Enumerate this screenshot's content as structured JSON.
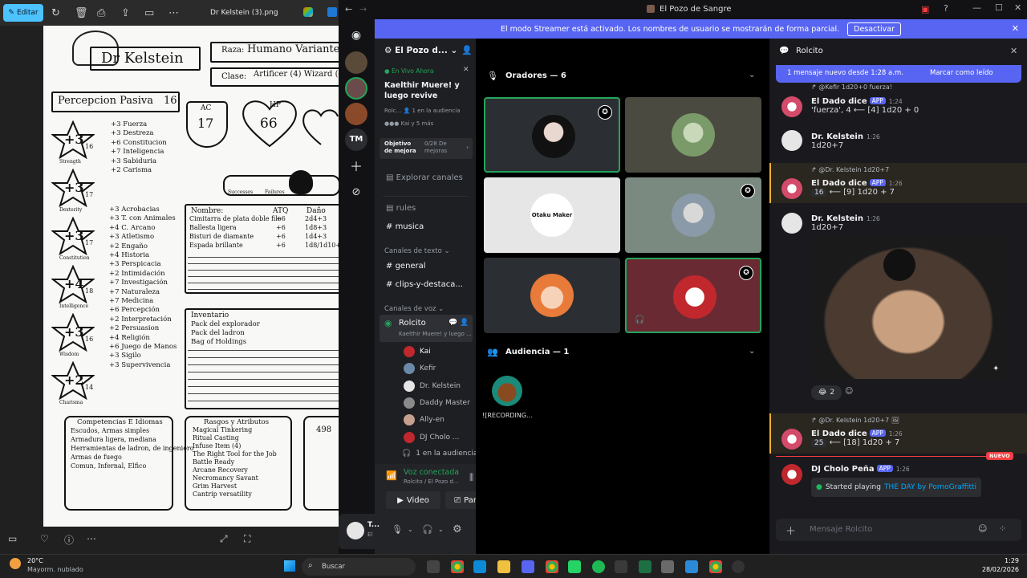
{
  "viewer": {
    "edit_label": "Editar",
    "file_title": "Dr Kelstein (3).png",
    "sheet": {
      "name": "Dr Kelstein",
      "race_label": "Raza:",
      "race": "Humano Variante",
      "class_label": "Clase:",
      "class": "Artificer (4) Wizard (4)",
      "passive_label": "Percepcion Pasiva",
      "passive": "16",
      "ac_label": "AC",
      "ac": "17",
      "hp_label": "HP",
      "hp": "66",
      "successes": "Successes",
      "failures": "Failures",
      "stats": [
        {
          "mod": "+3",
          "score": "16",
          "name": "Strength"
        },
        {
          "mod": "+3",
          "score": "17",
          "name": "Dexterity"
        },
        {
          "mod": "+3",
          "score": "17",
          "name": "Constitution"
        },
        {
          "mod": "+4",
          "score": "18",
          "name": "Intelligence"
        },
        {
          "mod": "+3",
          "score": "16",
          "name": "Wisdom"
        },
        {
          "mod": "+2",
          "score": "14",
          "name": "Charisma"
        }
      ],
      "saves": [
        "+3 Fuerza",
        "+3 Destreza",
        "+6 Constitucion",
        "+7 Inteligencia",
        "+3 Sabiduria",
        "+2 Carisma"
      ],
      "skills": [
        "+3 Acrobacias",
        "+3 T. con Animales",
        "+4 C. Arcano",
        "+3 Atletismo",
        "+2 Engaño",
        "+4 Historia",
        "+3 Perspicacia",
        "+2 Intimidación",
        "+7 Investigación",
        "+7 Naturaleza",
        "+7 Medicina",
        "+6 Percepción",
        "+2 Interpretación",
        "+2 Persuasion",
        "+4 Religión",
        "+6 Juego de Manos",
        "+3 Sigilo",
        "+3 Supervivencia"
      ],
      "attack_headers": [
        "Nombre:",
        "ATQ",
        "Daño"
      ],
      "attacks": [
        [
          "Cimitarra de plata doble filo",
          "+6",
          "2d4+3"
        ],
        [
          "Ballesta ligera",
          "+6",
          "1d8+3"
        ],
        [
          "Bisturi de diamante",
          "+6",
          "1d4+3"
        ],
        [
          "Espada brillante",
          "+6",
          "1d8/1d10+"
        ]
      ],
      "inventory_title": "Inventario",
      "inventory": [
        "Pack del explorador",
        "Pack del ladron",
        "Bag of Holdings"
      ],
      "prof_title": "Competencias E Idiomas",
      "prof": [
        "Escudos, Armas simples",
        "Armadura ligera, mediana",
        "Herramientas de ladron, de ingeniero",
        "Armas de fuego",
        "Comun, Infernal, Elfico"
      ],
      "traits_title": "Rasgos y Atributos",
      "traits": [
        "Magical Tinkering",
        "Ritual Casting",
        "Infuse Item (4)",
        "The Right Tool for the Job",
        "Battle Ready",
        "Arcane Recovery",
        "Necromancy Savant",
        "Grim Harvest",
        "Cantrip versatility"
      ],
      "side_num": "498"
    }
  },
  "discord": {
    "window_title": "El Pozo de Sangre",
    "streamer_text": "El modo Streamer está activado. Los nombres de usuario se mostrarán de forma parcial.",
    "streamer_button": "Desactivar",
    "guild_tm": "TM",
    "server_name": "El Pozo d...",
    "live_now": "En Vivo Ahora",
    "stage_title": "Kaelthir Muere! y luego revive",
    "stage_sub": "Rolc...",
    "stage_audience": "1 en la audiencia",
    "stage_people": "Kai y 5 más",
    "boost_label": "Objetivo de mejora",
    "boost_value": "0/28 De mejoras",
    "explore": "Explorar canales",
    "channels_top": [
      "rules",
      "musica"
    ],
    "text_cat": "Canales de texto",
    "text_channels": [
      "general",
      "clips-y-destaca..."
    ],
    "voice_cat": "Canales de voz",
    "voice_channel": "Rolcito",
    "voice_sub": "Kaelthir Muere! y luego ...",
    "voice_users": [
      "Kai",
      "Kefir",
      "Dr. Kelstein",
      "Daddy Master",
      "Ally-en",
      "DJ Cholo ..."
    ],
    "voice_audience": "1 en la audiencia",
    "voice_connected": "Voz conectada",
    "voice_connected_sub": "Rolcito / El Pozo d...",
    "video_btn": "Video",
    "screen_btn": "Pantall",
    "user_name": "T...",
    "user_status": "El",
    "speakers_title": "Oradores — 6",
    "audience_title": "Audiencia — 1",
    "audience_member": "![RECORDING...",
    "tile_logo": "Otaku Maker",
    "chat": {
      "channel": "Rolcito",
      "new_banner": "1 mensaje nuevo desde 1:28 a.m.",
      "mark_read": "Marcar como leído",
      "messages": [
        {
          "reply": "@Kefir 1d20+0 fuerza!",
          "user": "El Dado dice",
          "tag": "APP",
          "time": "1:24",
          "text": "'fuerza', 4 ⟵ [4] 1d20 + 0"
        },
        {
          "user": "Dr. Kelstein",
          "time": "1:26",
          "text": "1d20+7"
        },
        {
          "reply": "@Dr. Kelstein 1d20+7",
          "user": "El Dado dice",
          "tag": "APP",
          "time": "1:26",
          "result": "16",
          "text": "⟵ [9] 1d20 + 7"
        },
        {
          "user": "Dr. Kelstein",
          "time": "1:26",
          "text": "1d20+7"
        },
        {
          "reply": "@Dr. Kelstein 1d20+7",
          "user": "El Dado dice",
          "tag": "APP",
          "time": "1:26",
          "result": "25",
          "text": "⟵ [18] 1d20 + 7"
        },
        {
          "user": "DJ Cholo Peña",
          "tag": "APP",
          "time": "1:26",
          "activity": "Started playing",
          "song": "THE DAY by PornoGraffitti"
        }
      ],
      "reaction_count": "2",
      "new_tag": "NUEVO",
      "input_placeholder": "Mensaje Rolcito"
    }
  },
  "taskbar": {
    "weather_temp": "20°C",
    "weather_desc": "Mayorm. nublado",
    "search": "Buscar",
    "time": "1:29",
    "date": "28/02/2026"
  }
}
